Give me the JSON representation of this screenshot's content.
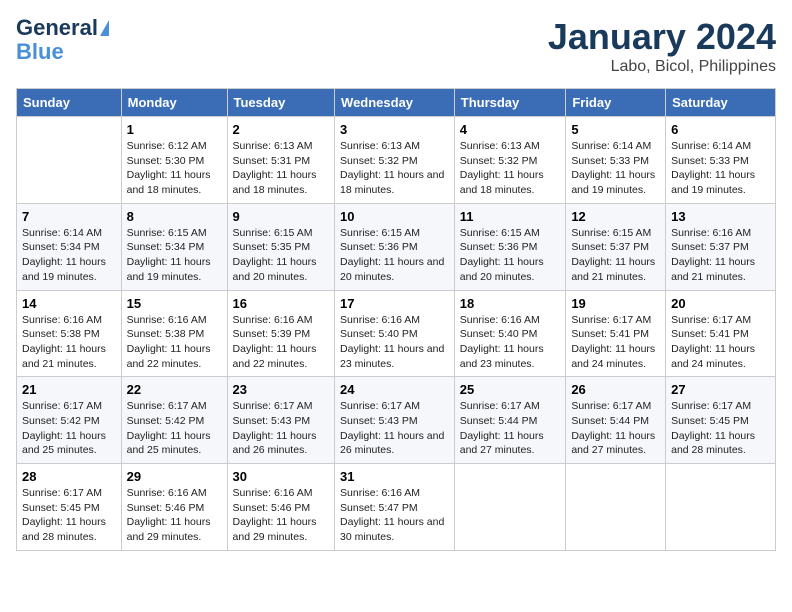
{
  "header": {
    "logo_general": "General",
    "logo_blue": "Blue",
    "title": "January 2024",
    "subtitle": "Labo, Bicol, Philippines"
  },
  "days_of_week": [
    "Sunday",
    "Monday",
    "Tuesday",
    "Wednesday",
    "Thursday",
    "Friday",
    "Saturday"
  ],
  "weeks": [
    [
      {
        "day": "",
        "sunrise": "",
        "sunset": "",
        "daylight": ""
      },
      {
        "day": "1",
        "sunrise": "6:12 AM",
        "sunset": "5:30 PM",
        "daylight": "11 hours and 18 minutes."
      },
      {
        "day": "2",
        "sunrise": "6:13 AM",
        "sunset": "5:31 PM",
        "daylight": "11 hours and 18 minutes."
      },
      {
        "day": "3",
        "sunrise": "6:13 AM",
        "sunset": "5:32 PM",
        "daylight": "11 hours and 18 minutes."
      },
      {
        "day": "4",
        "sunrise": "6:13 AM",
        "sunset": "5:32 PM",
        "daylight": "11 hours and 18 minutes."
      },
      {
        "day": "5",
        "sunrise": "6:14 AM",
        "sunset": "5:33 PM",
        "daylight": "11 hours and 19 minutes."
      },
      {
        "day": "6",
        "sunrise": "6:14 AM",
        "sunset": "5:33 PM",
        "daylight": "11 hours and 19 minutes."
      }
    ],
    [
      {
        "day": "7",
        "sunrise": "6:14 AM",
        "sunset": "5:34 PM",
        "daylight": "11 hours and 19 minutes."
      },
      {
        "day": "8",
        "sunrise": "6:15 AM",
        "sunset": "5:34 PM",
        "daylight": "11 hours and 19 minutes."
      },
      {
        "day": "9",
        "sunrise": "6:15 AM",
        "sunset": "5:35 PM",
        "daylight": "11 hours and 20 minutes."
      },
      {
        "day": "10",
        "sunrise": "6:15 AM",
        "sunset": "5:36 PM",
        "daylight": "11 hours and 20 minutes."
      },
      {
        "day": "11",
        "sunrise": "6:15 AM",
        "sunset": "5:36 PM",
        "daylight": "11 hours and 20 minutes."
      },
      {
        "day": "12",
        "sunrise": "6:15 AM",
        "sunset": "5:37 PM",
        "daylight": "11 hours and 21 minutes."
      },
      {
        "day": "13",
        "sunrise": "6:16 AM",
        "sunset": "5:37 PM",
        "daylight": "11 hours and 21 minutes."
      }
    ],
    [
      {
        "day": "14",
        "sunrise": "6:16 AM",
        "sunset": "5:38 PM",
        "daylight": "11 hours and 21 minutes."
      },
      {
        "day": "15",
        "sunrise": "6:16 AM",
        "sunset": "5:38 PM",
        "daylight": "11 hours and 22 minutes."
      },
      {
        "day": "16",
        "sunrise": "6:16 AM",
        "sunset": "5:39 PM",
        "daylight": "11 hours and 22 minutes."
      },
      {
        "day": "17",
        "sunrise": "6:16 AM",
        "sunset": "5:40 PM",
        "daylight": "11 hours and 23 minutes."
      },
      {
        "day": "18",
        "sunrise": "6:16 AM",
        "sunset": "5:40 PM",
        "daylight": "11 hours and 23 minutes."
      },
      {
        "day": "19",
        "sunrise": "6:17 AM",
        "sunset": "5:41 PM",
        "daylight": "11 hours and 24 minutes."
      },
      {
        "day": "20",
        "sunrise": "6:17 AM",
        "sunset": "5:41 PM",
        "daylight": "11 hours and 24 minutes."
      }
    ],
    [
      {
        "day": "21",
        "sunrise": "6:17 AM",
        "sunset": "5:42 PM",
        "daylight": "11 hours and 25 minutes."
      },
      {
        "day": "22",
        "sunrise": "6:17 AM",
        "sunset": "5:42 PM",
        "daylight": "11 hours and 25 minutes."
      },
      {
        "day": "23",
        "sunrise": "6:17 AM",
        "sunset": "5:43 PM",
        "daylight": "11 hours and 26 minutes."
      },
      {
        "day": "24",
        "sunrise": "6:17 AM",
        "sunset": "5:43 PM",
        "daylight": "11 hours and 26 minutes."
      },
      {
        "day": "25",
        "sunrise": "6:17 AM",
        "sunset": "5:44 PM",
        "daylight": "11 hours and 27 minutes."
      },
      {
        "day": "26",
        "sunrise": "6:17 AM",
        "sunset": "5:44 PM",
        "daylight": "11 hours and 27 minutes."
      },
      {
        "day": "27",
        "sunrise": "6:17 AM",
        "sunset": "5:45 PM",
        "daylight": "11 hours and 28 minutes."
      }
    ],
    [
      {
        "day": "28",
        "sunrise": "6:17 AM",
        "sunset": "5:45 PM",
        "daylight": "11 hours and 28 minutes."
      },
      {
        "day": "29",
        "sunrise": "6:16 AM",
        "sunset": "5:46 PM",
        "daylight": "11 hours and 29 minutes."
      },
      {
        "day": "30",
        "sunrise": "6:16 AM",
        "sunset": "5:46 PM",
        "daylight": "11 hours and 29 minutes."
      },
      {
        "day": "31",
        "sunrise": "6:16 AM",
        "sunset": "5:47 PM",
        "daylight": "11 hours and 30 minutes."
      },
      {
        "day": "",
        "sunrise": "",
        "sunset": "",
        "daylight": ""
      },
      {
        "day": "",
        "sunrise": "",
        "sunset": "",
        "daylight": ""
      },
      {
        "day": "",
        "sunrise": "",
        "sunset": "",
        "daylight": ""
      }
    ]
  ]
}
